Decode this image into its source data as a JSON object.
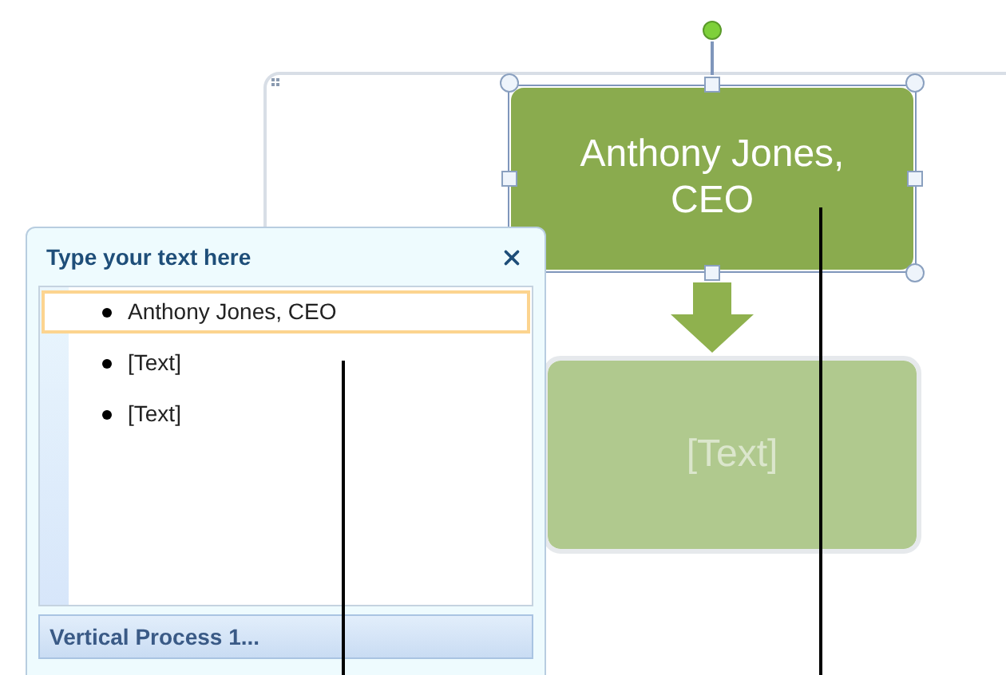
{
  "diagram": {
    "shapes": [
      {
        "text": "Anthony Jones, CEO",
        "selected": true,
        "placeholder": false
      },
      {
        "text": "[Text]",
        "selected": false,
        "placeholder": true
      }
    ]
  },
  "text_pane": {
    "title": "Type your text here",
    "items": [
      {
        "text": "Anthony Jones, CEO",
        "selected": true
      },
      {
        "text": "[Text]",
        "selected": false
      },
      {
        "text": "[Text]",
        "selected": false
      }
    ],
    "footer": "Vertical Process 1..."
  }
}
